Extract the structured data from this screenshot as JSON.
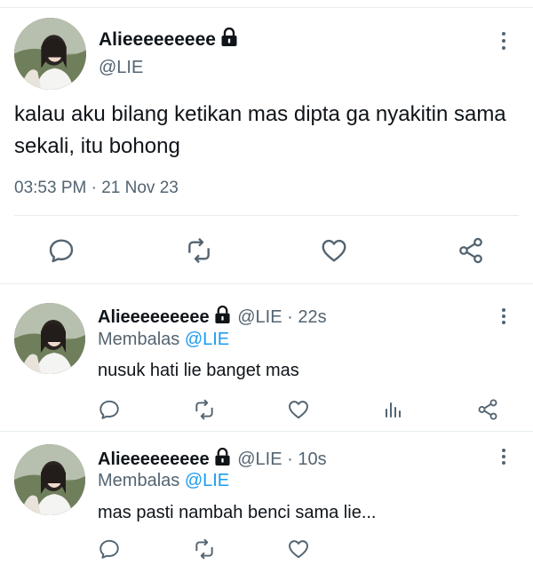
{
  "main_tweet": {
    "display_name": "Alieeeeeeeee",
    "handle": "@LIE",
    "text": "kalau aku bilang ketikan mas dipta ga nyakitin sama sekali, itu bohong",
    "timestamp": "03:53 PM · 21 Nov 23"
  },
  "replies": [
    {
      "display_name": "Alieeeeeeeee",
      "meta": "@LIE · 22s",
      "replying_prefix": "Membalas",
      "replying_to": "@LIE",
      "text": "nusuk hati lie banget mas"
    },
    {
      "display_name": "Alieeeeeeeee",
      "meta": "@LIE · 10s",
      "replying_prefix": "Membalas",
      "replying_to": "@LIE",
      "text": "mas pasti nambah benci sama lie..."
    }
  ],
  "icons": [
    "lock-icon",
    "more-icon",
    "reply-icon",
    "retweet-icon",
    "like-icon",
    "share-icon",
    "analytics-icon"
  ],
  "colors": {
    "text": "#0f1419",
    "muted": "#536471",
    "link": "#1d9bf0",
    "divider": "#e6ecf0"
  }
}
